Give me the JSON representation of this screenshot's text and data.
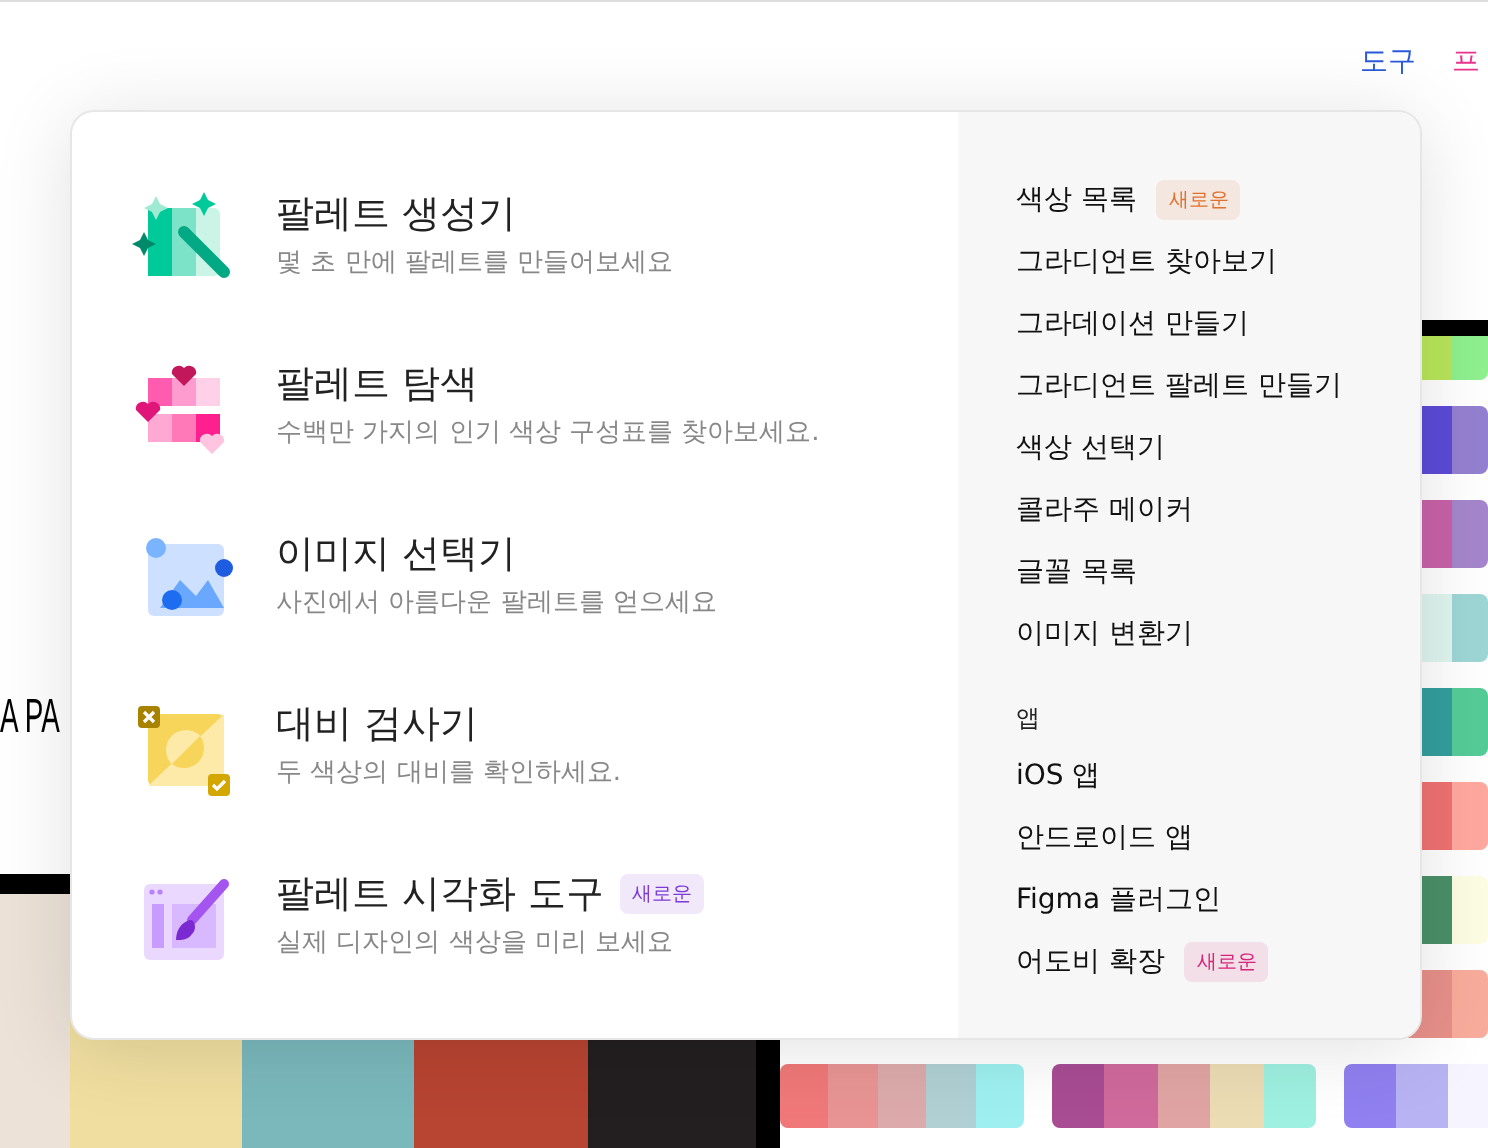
{
  "header": {
    "nav": [
      {
        "label": "도구",
        "color": "#2b5bd8"
      },
      {
        "label": "프",
        "color": "#e8338f"
      }
    ]
  },
  "hero_text": "A PA",
  "hero_palette": [
    {
      "color": "#ece2d8"
    },
    {
      "color": "#f0dea0"
    },
    {
      "color": "#7ab8bc"
    },
    {
      "color": "#b84432"
    },
    {
      "color": "#231f20"
    }
  ],
  "side_palettes": [
    {
      "swatches": [
        {
          "color": "#b8e65a"
        },
        {
          "color": "#8ef08e"
        }
      ]
    },
    {
      "swatches": [
        {
          "color": "#5b4bd8"
        },
        {
          "color": "#9480d0"
        }
      ]
    },
    {
      "swatches": [
        {
          "color": "#c862a8"
        },
        {
          "color": "#a586cc"
        }
      ]
    },
    {
      "swatches": [
        {
          "color": "#dff5ef"
        },
        {
          "color": "#9ed6d6"
        }
      ]
    },
    {
      "swatches": [
        {
          "color": "#349e9e"
        },
        {
          "color": "#55cc98"
        }
      ]
    },
    {
      "swatches": [
        {
          "color": "#f07272"
        },
        {
          "color": "#ffa8a0"
        }
      ]
    },
    {
      "swatches": [
        {
          "color": "#4a9068"
        },
        {
          "color": "#fdfde4"
        }
      ]
    },
    {
      "swatches": [
        {
          "color": "#e8908a"
        },
        {
          "color": "#f8ac9c"
        }
      ]
    }
  ],
  "bottom_palettes": [
    {
      "swatches": [
        {
          "color": "#f07878"
        },
        {
          "color": "#e89494"
        },
        {
          "color": "#dcaaaa"
        },
        {
          "color": "#b0d0d4"
        },
        {
          "color": "#9ef0f0"
        }
      ]
    },
    {
      "swatches": [
        {
          "color": "#a84c94"
        },
        {
          "color": "#d06a9c"
        },
        {
          "color": "#e0a4a4"
        },
        {
          "color": "#ecdcb4"
        },
        {
          "color": "#9ef0e0"
        }
      ]
    },
    {
      "swatches": [
        {
          "color": "#9080f0"
        },
        {
          "color": "#b8b4f4"
        },
        {
          "color": "#f6f4fe"
        }
      ]
    }
  ],
  "tools_menu": {
    "tools": [
      {
        "kind": "generator",
        "title": "팔레트 생성기",
        "description": "몇 초 만에 팔레트를 만들어보세요"
      },
      {
        "kind": "explore",
        "title": "팔레트 탐색",
        "description": "수백만 가지의 인기 색상 구성표를 찾아보세요."
      },
      {
        "kind": "image",
        "title": "이미지 선택기",
        "description": "사진에서 아름다운 팔레트를 얻으세요"
      },
      {
        "kind": "contrast",
        "title": "대비 검사기",
        "description": "두 색상의 대비를 확인하세요."
      },
      {
        "kind": "visualizer",
        "title": "팔레트 시각화 도구",
        "description": "실제 디자인의 색상을 미리 보세요",
        "badge": {
          "text": "새로운",
          "color": "#7c3ad6"
        }
      }
    ],
    "links": [
      {
        "label": "색상 목록",
        "badge": {
          "text": "새로운",
          "color": "#e0702a"
        }
      },
      {
        "label": "그라디언트 찾아보기"
      },
      {
        "label": "그라데이션 만들기"
      },
      {
        "label": "그라디언트 팔레트 만들기"
      },
      {
        "label": "색상 선택기"
      },
      {
        "label": "콜라주 메이커"
      },
      {
        "label": "글꼴 목록"
      },
      {
        "label": "이미지 변환기"
      }
    ],
    "apps_heading": "앱",
    "apps": [
      {
        "label": "iOS 앱"
      },
      {
        "label": "안드로이드 앱"
      },
      {
        "label": "Figma 플러그인"
      },
      {
        "label": "어도비 확장",
        "badge": {
          "text": "새로운",
          "color": "#d6247a"
        }
      }
    ]
  }
}
